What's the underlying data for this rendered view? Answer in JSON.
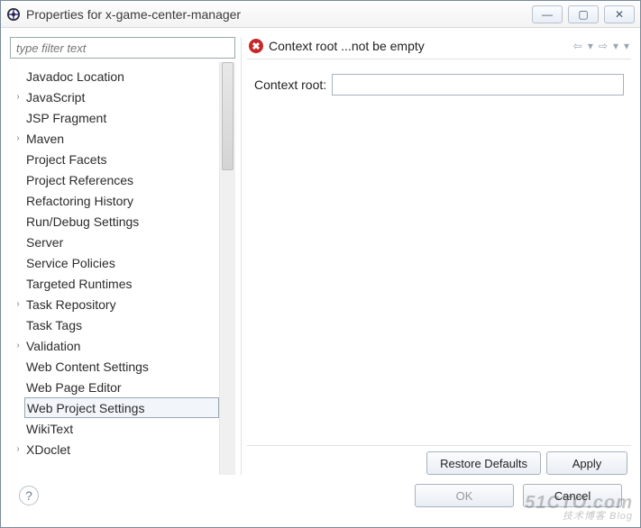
{
  "window": {
    "title": "Properties for x-game-center-manager",
    "controls": {
      "minimize": "—",
      "maximize": "▢",
      "close": "✕"
    }
  },
  "filter": {
    "placeholder": "type filter text"
  },
  "tree": {
    "items": [
      {
        "label": "Javadoc Location",
        "expandable": false
      },
      {
        "label": "JavaScript",
        "expandable": true
      },
      {
        "label": "JSP Fragment",
        "expandable": false
      },
      {
        "label": "Maven",
        "expandable": true
      },
      {
        "label": "Project Facets",
        "expandable": false
      },
      {
        "label": "Project References",
        "expandable": false
      },
      {
        "label": "Refactoring History",
        "expandable": false
      },
      {
        "label": "Run/Debug Settings",
        "expandable": false
      },
      {
        "label": "Server",
        "expandable": false
      },
      {
        "label": "Service Policies",
        "expandable": false
      },
      {
        "label": "Targeted Runtimes",
        "expandable": false
      },
      {
        "label": "Task Repository",
        "expandable": true
      },
      {
        "label": "Task Tags",
        "expandable": false
      },
      {
        "label": "Validation",
        "expandable": true
      },
      {
        "label": "Web Content Settings",
        "expandable": false
      },
      {
        "label": "Web Page Editor",
        "expandable": false
      },
      {
        "label": "Web Project Settings",
        "expandable": false,
        "selected": true
      },
      {
        "label": "WikiText",
        "expandable": false
      },
      {
        "label": "XDoclet",
        "expandable": true
      }
    ]
  },
  "banner": {
    "message": "Context root ...not be empty"
  },
  "form": {
    "context_root_label": "Context root:",
    "context_root_value": ""
  },
  "buttons": {
    "restore_defaults": "Restore Defaults",
    "apply": "Apply",
    "ok": "OK",
    "cancel": "Cancel"
  },
  "watermark": {
    "main": "51CTO.com",
    "sub": "技术博客  Blog"
  }
}
